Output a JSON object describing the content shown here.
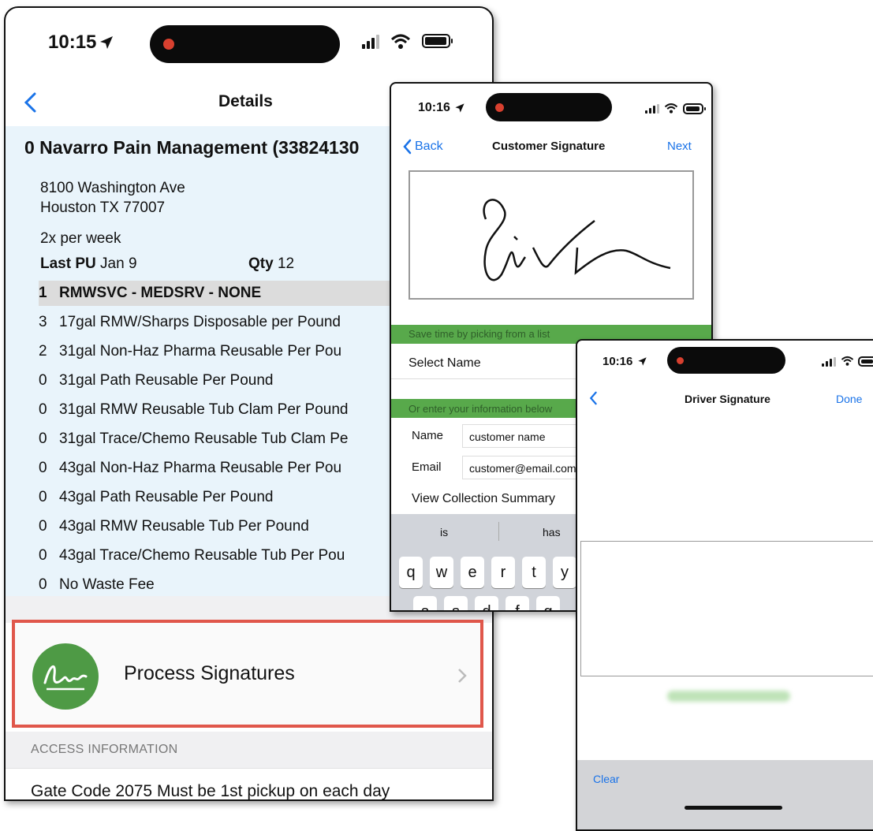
{
  "phone1": {
    "status_time": "10:15",
    "nav_title": "Details",
    "customer_title": "0 Navarro Pain Management (33824130",
    "address_line1": "8100 Washington Ave",
    "address_line2": "Houston TX 77007",
    "frequency": "2x per week",
    "last_pu_label": "Last PU",
    "last_pu_value": "Jan 9",
    "qty_label": "Qty",
    "qty_value": "12",
    "services": [
      {
        "qty": "1",
        "name": "RMWSVC - MEDSRV - NONE"
      },
      {
        "qty": "3",
        "name": "17gal RMW/Sharps Disposable per Pound"
      },
      {
        "qty": "2",
        "name": "31gal Non-Haz Pharma Reusable Per Pou"
      },
      {
        "qty": "0",
        "name": "31gal Path Reusable Per Pound"
      },
      {
        "qty": "0",
        "name": "31gal RMW Reusable Tub Clam Per Pound"
      },
      {
        "qty": "0",
        "name": "31gal Trace/Chemo Reusable Tub Clam Pe"
      },
      {
        "qty": "0",
        "name": "43gal Non-Haz Pharma Reusable Per Pou"
      },
      {
        "qty": "0",
        "name": "43gal Path Reusable Per Pound"
      },
      {
        "qty": "0",
        "name": "43gal RMW Reusable Tub Per Pound"
      },
      {
        "qty": "0",
        "name": "43gal Trace/Chemo Reusable Tub Per Pou"
      },
      {
        "qty": "0",
        "name": "No Waste Fee"
      }
    ],
    "process_signatures_label": "Process Signatures",
    "access_header": "ACCESS INFORMATION",
    "access_text": "Gate Code 2075 Must be 1st pickup on each day"
  },
  "phone2": {
    "status_time": "10:16",
    "back_label": "Back",
    "nav_title": "Customer Signature",
    "next_label": "Next",
    "pick_hint": "Save time by picking from a list",
    "select_name_label": "Select Name",
    "enter_hint": "Or enter your information below",
    "name_label": "Name",
    "name_value": "customer name",
    "email_label": "Email",
    "email_value": "customer@email.com",
    "view_summary_label": "View Collection Summary",
    "suggestions": [
      "is",
      "has"
    ],
    "keys_row1": [
      "q",
      "w",
      "e",
      "r",
      "t",
      "y"
    ],
    "keys_row2": [
      "a",
      "s",
      "d",
      "f",
      "g"
    ]
  },
  "phone3": {
    "status_time": "10:16",
    "nav_title": "Driver Signature",
    "done_label": "Done",
    "clear_label": "Clear"
  },
  "colors": {
    "ios_blue": "#1a73e8",
    "highlight_red": "#e0574b",
    "signature_green": "#4e9a45",
    "hint_green": "#58a94b",
    "light_blue_bg": "#e9f4fb"
  }
}
